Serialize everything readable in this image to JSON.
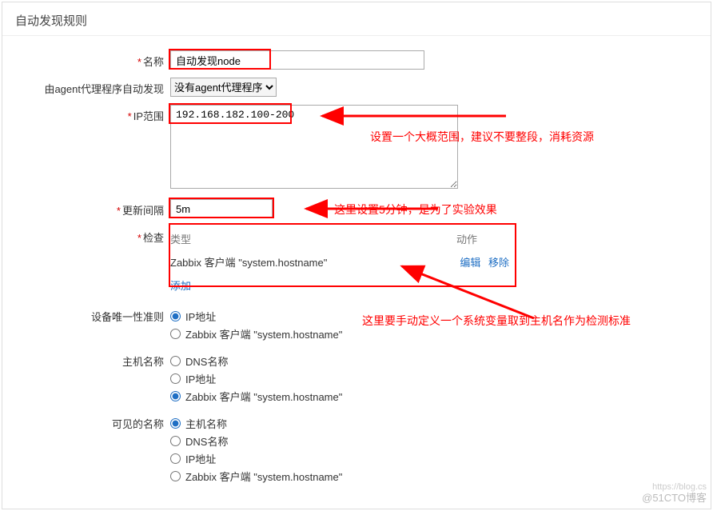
{
  "page": {
    "title": "自动发现规则"
  },
  "form": {
    "name": {
      "label": "名称",
      "value": "自动发现node"
    },
    "proxy": {
      "label": "由agent代理程序自动发现",
      "selected": "没有agent代理程序"
    },
    "ip_range": {
      "label": "IP范围",
      "value": "192.168.182.100-200"
    },
    "interval": {
      "label": "更新间隔",
      "value": "5m"
    },
    "checks": {
      "label": "检查",
      "col_type": "类型",
      "col_action": "动作",
      "row_text": "Zabbix 客户端 \"system.hostname\"",
      "edit": "编辑",
      "remove": "移除",
      "add": "添加"
    },
    "uniqueness": {
      "label": "设备唯一性准则",
      "options": [
        "IP地址",
        "Zabbix 客户端 \"system.hostname\""
      ],
      "selected": 0
    },
    "hostname": {
      "label": "主机名称",
      "options": [
        "DNS名称",
        "IP地址",
        "Zabbix 客户端 \"system.hostname\""
      ],
      "selected": 2
    },
    "visible_name": {
      "label": "可见的名称",
      "options": [
        "主机名称",
        "DNS名称",
        "IP地址",
        "Zabbix 客户端 \"system.hostname\""
      ],
      "selected": 0
    }
  },
  "annotations": {
    "ip_note": "设置一个大概范围，建议不要整段，消耗资源",
    "interval_note": "这里设置5分钟，是为了实验效果",
    "checks_note": "这里要手动定义一个系统变量取到主机名作为检测标准"
  },
  "watermark": {
    "line1": "https://blog.cs",
    "line2": "@51CTO博客"
  }
}
